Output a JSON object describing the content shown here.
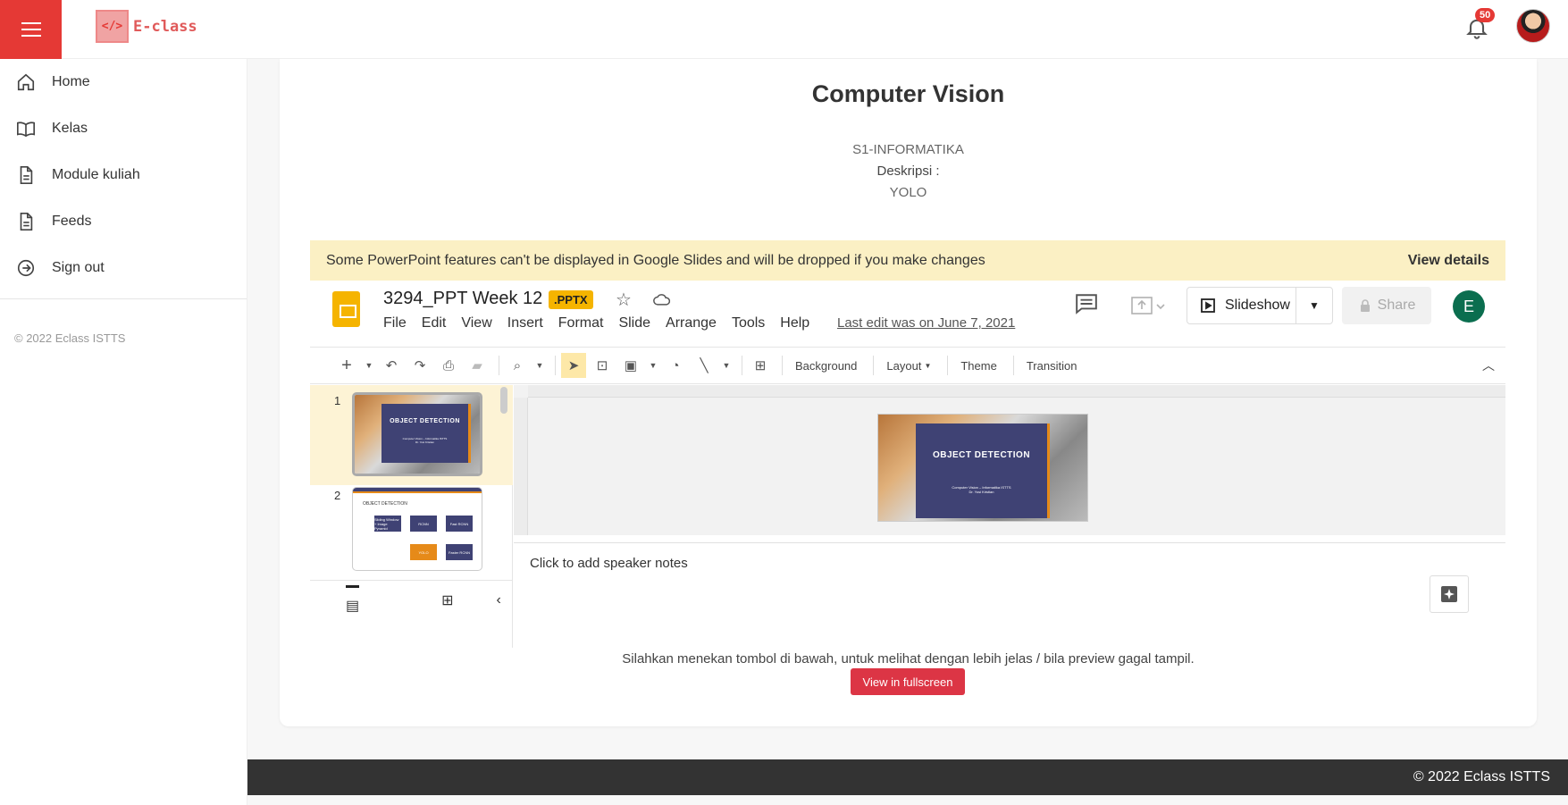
{
  "app": {
    "logo_mark": "</>",
    "logo_text": "E-class",
    "notifications": "50"
  },
  "sidebar": {
    "items": [
      {
        "label": "Home",
        "icon": "home-icon"
      },
      {
        "label": "Kelas",
        "icon": "book-icon"
      },
      {
        "label": "Module kuliah",
        "icon": "document-icon"
      },
      {
        "label": "Feeds",
        "icon": "document-icon"
      },
      {
        "label": "Sign out",
        "icon": "sign-out-icon"
      }
    ],
    "copyright": "© 2022 Eclass ISTTS"
  },
  "course": {
    "title": "Computer Vision",
    "program": "S1-INFORMATIKA",
    "desc_label": "Deskripsi :",
    "desc_value": "YOLO"
  },
  "slides_embed": {
    "warning": "Some PowerPoint features can't be displayed in Google Slides and will be dropped if you make changes",
    "view_details": "View details",
    "doc_title": "3294_PPT Week 12",
    "badge": ".PPTX",
    "menu": [
      "File",
      "Edit",
      "View",
      "Insert",
      "Format",
      "Slide",
      "Arrange",
      "Tools",
      "Help"
    ],
    "last_edit": "Last edit was on June 7, 2021",
    "slideshow": "Slideshow",
    "share": "Share",
    "account_initial": "E",
    "toolbar": {
      "background": "Background",
      "layout": "Layout",
      "theme": "Theme",
      "transition": "Transition"
    },
    "slides": [
      {
        "number": "1",
        "title": "OBJECT DETECTION",
        "subtitle": "Computer Vision – Informatika ISTTS",
        "author": "Dr. Yosi Kristian"
      },
      {
        "number": "2",
        "title": "OBJECT DETECTION",
        "boxes": [
          "Sliding Window + Image Pyramid",
          "RCNN",
          "Fast RCNN",
          "YOLO",
          "Faster RCNN"
        ]
      }
    ],
    "notes_placeholder": "Click to add speaker notes"
  },
  "fullscreen": {
    "note": "Silahkan menekan tombol di bawah, untuk melihat dengan lebih jelas / bila preview gagal tampil.",
    "button": "View in fullscreen"
  },
  "footer": {
    "text": "© 2022 Eclass ISTTS"
  },
  "colors": {
    "accent": "#e53935",
    "slides_yellow": "#f5b400",
    "slide_navy": "#3f4274",
    "slide_orange": "#e68a19",
    "danger": "#dc3545"
  }
}
